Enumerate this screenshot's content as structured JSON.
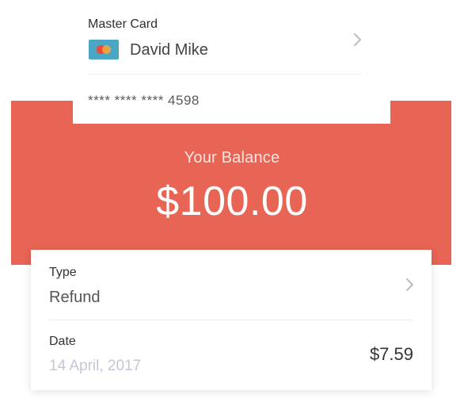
{
  "card": {
    "title": "Master Card",
    "holder": "David Mike",
    "number": "**** **** **** 4598",
    "logo_icon": "mastercard-logo-icon",
    "chevron_icon": "chevron-right-icon"
  },
  "balance": {
    "label": "Your Balance",
    "amount": "$100.00"
  },
  "transaction": {
    "type_label": "Type",
    "type_value": "Refund",
    "date_label": "Date",
    "date_value": "14 April, 2017",
    "amount": "$7.59",
    "chevron_icon": "chevron-right-icon"
  },
  "colors": {
    "accent": "#e86454",
    "date_text": "#c3c7d3",
    "chevron": "#b8bcc8"
  }
}
